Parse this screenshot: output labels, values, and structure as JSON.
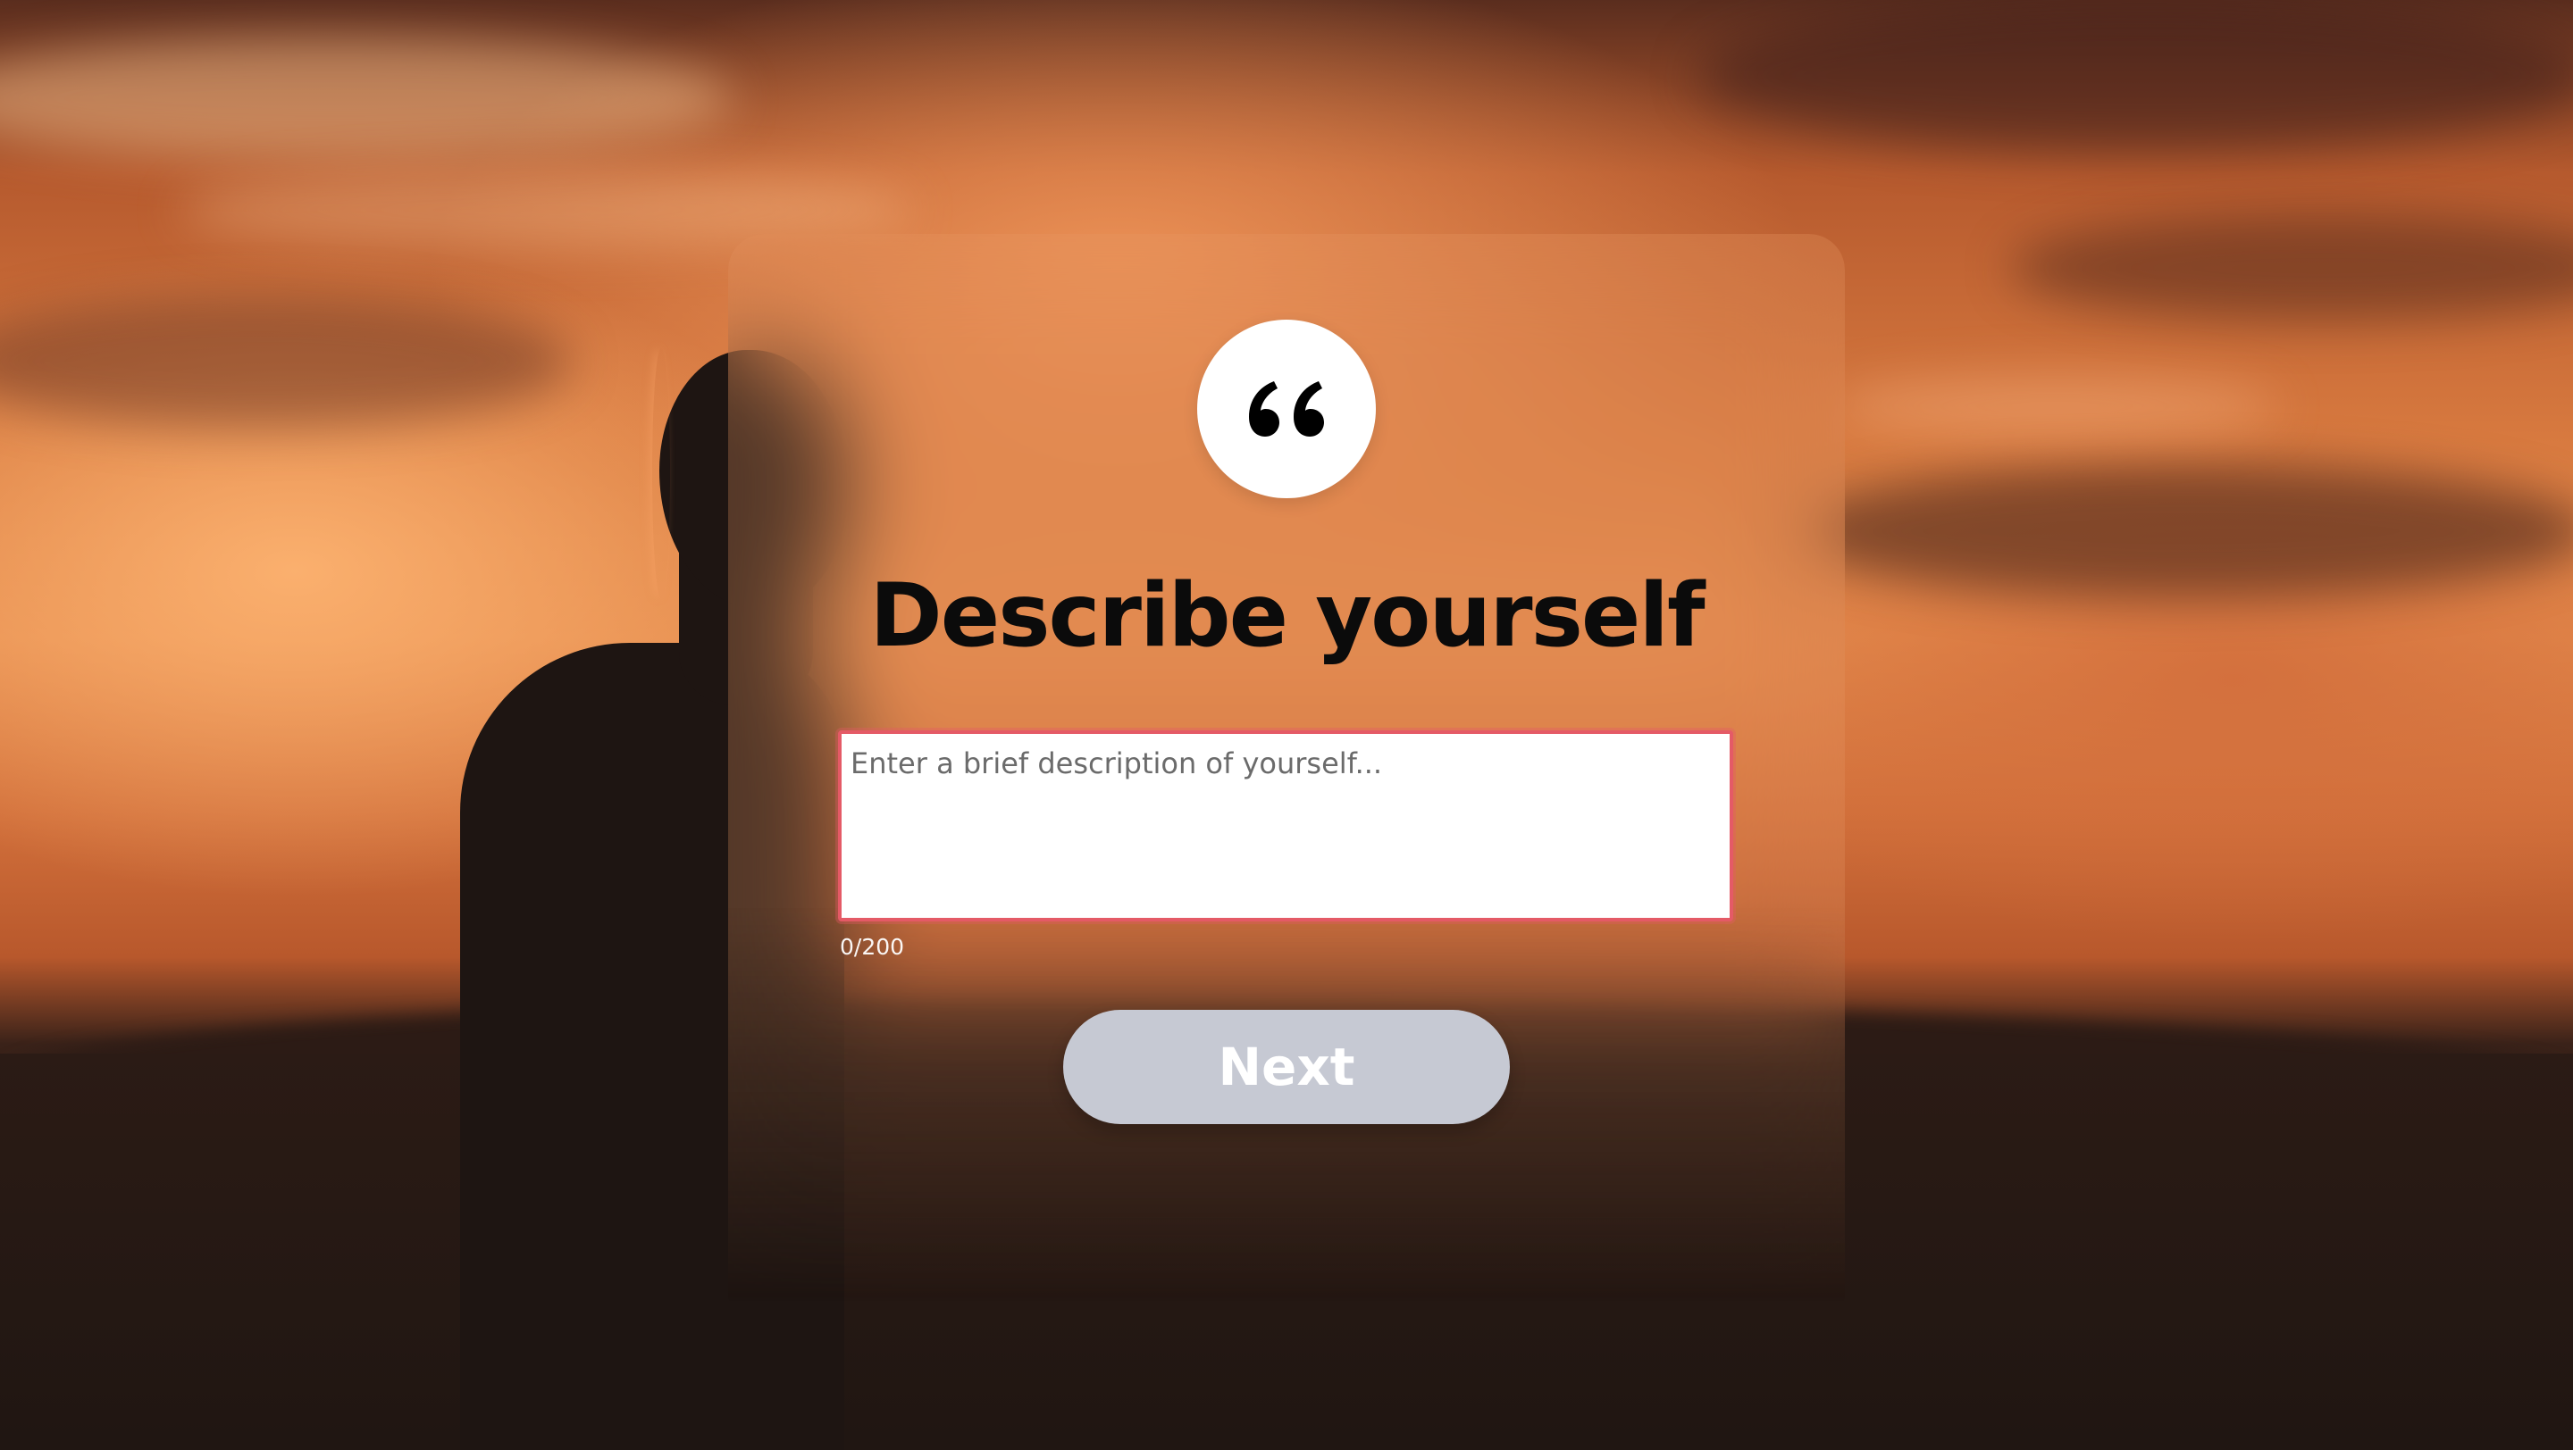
{
  "form": {
    "icon": "quote-icon",
    "title": "Describe yourself",
    "description": {
      "value": "",
      "placeholder": "Enter a brief description of yourself...",
      "char_count": "0/200"
    },
    "next_label": "Next"
  },
  "colors": {
    "input_border": "#e45a66",
    "button_bg": "#c6c9d3",
    "title_text": "#0b0b0b"
  }
}
